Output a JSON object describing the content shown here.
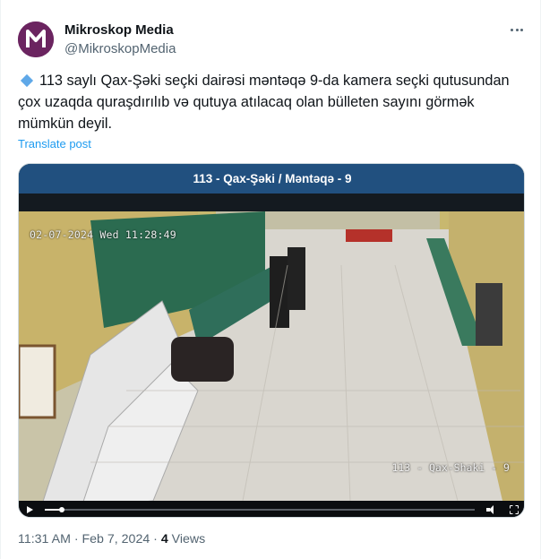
{
  "author": {
    "display_name": "Mikroskop Media",
    "handle": "@MikroskopMedia",
    "avatar_letter": "M",
    "avatar_color": "#6b2460"
  },
  "tweet": {
    "bullet_icon": "blue-diamond-icon",
    "text": "113 saylı Qax-Şəki seçki dairəsi məntəqə 9-da kamera seçki qutusundan çox uzaqda quraşdırılıb və qutuya atılacaq olan bülleten sayını görmək mümkün deyil.",
    "translate_label": "Translate post"
  },
  "media": {
    "banner_title": "113 - Qax-Şəki / Məntəqə - 9",
    "banner_color": "#21507f",
    "osd_timestamp": "02-07-2024 Wed 11:28:49",
    "osd_camera_name": "113 - Qax-Shaki - 9",
    "progress": 0.04
  },
  "footer": {
    "time": "11:31 AM",
    "separator": " · ",
    "date": "Feb 7, 2024",
    "views_count": "4",
    "views_label": " Views"
  },
  "colors": {
    "link": "#1d9bf0",
    "secondary_text": "#536471"
  }
}
